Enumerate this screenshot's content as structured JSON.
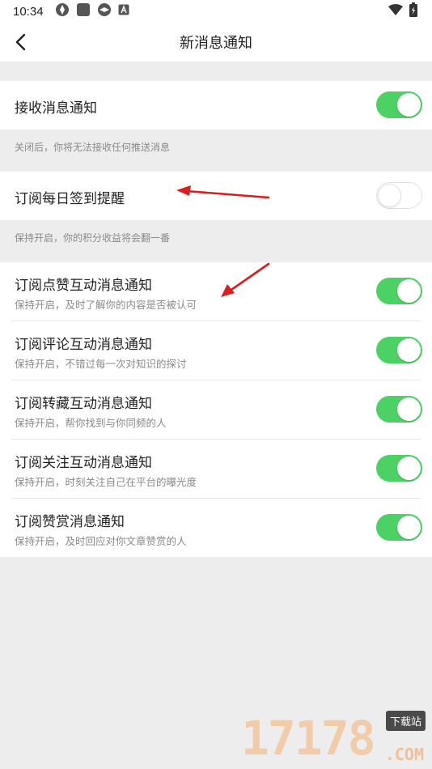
{
  "status_bar": {
    "time": "10:34",
    "icons": [
      "app-icon-1",
      "app-icon-2",
      "app-icon-3",
      "a-icon"
    ],
    "right_icons": [
      "wifi-icon",
      "battery-icon"
    ]
  },
  "header": {
    "title": "新消息通知",
    "back_icon": "chevron-left-icon"
  },
  "colors": {
    "toggle_on": "#4cd264",
    "background": "#ededed"
  },
  "settings": {
    "receive": {
      "label": "接收消息通知",
      "enabled": true,
      "hint": "关闭后，你将无法接收任何推送消息"
    },
    "daily_checkin": {
      "label": "订阅每日签到提醒",
      "enabled": false,
      "hint": "保持开启，你的积分收益将会翻一番"
    },
    "items": [
      {
        "label": "订阅点赞互动消息通知",
        "sub": "保持开启，及时了解你的内容是否被认可",
        "enabled": true
      },
      {
        "label": "订阅评论互动消息通知",
        "sub": "保持开启，不错过每一次对知识的探讨",
        "enabled": true
      },
      {
        "label": "订阅转藏互动消息通知",
        "sub": "保持开启，帮你找到与你同频的人",
        "enabled": true
      },
      {
        "label": "订阅关注互动消息通知",
        "sub": "保持开启，时刻关注自己在平台的曝光度",
        "enabled": true
      },
      {
        "label": "订阅赞赏消息通知",
        "sub": "保持开启，及时回应对你文章赞赏的人",
        "enabled": true
      }
    ]
  },
  "watermark": {
    "digits": "17178",
    "badge": "下载站",
    "suffix": ".COM"
  }
}
